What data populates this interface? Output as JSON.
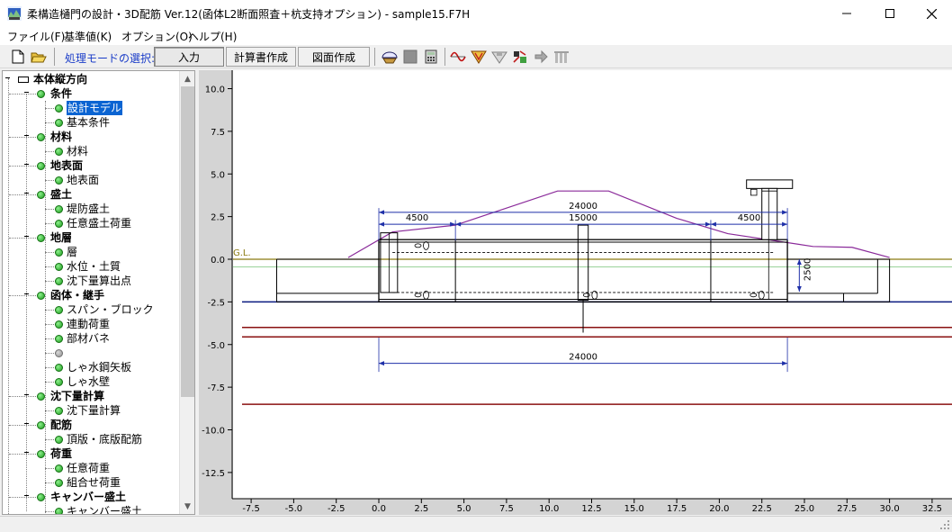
{
  "window": {
    "title": "柔構造樋門の設計・3D配筋 Ver.12(函体L2断面照査＋杭支持オプション) - sample15.F7H",
    "app_icon": "app-icon",
    "controls": [
      "minimize-icon",
      "maximize-icon",
      "close-icon"
    ]
  },
  "menu": {
    "items": [
      "ファイル(F)",
      "基準値(K)",
      "オプション(O)",
      "ヘルプ(H)"
    ]
  },
  "toolbar": {
    "mode_label": "処理モードの選択:",
    "input_label": "入力",
    "calc_label": "計算書作成",
    "drawing_label": "図面作成",
    "left_icons": [
      "new-file-icon",
      "open-folder-icon"
    ],
    "right_icons": [
      "ground-shape-icon",
      "gray-square-icon",
      "calculator-icon",
      "wave-load-icon",
      "earth-pressure-icon",
      "settlement-icon",
      "rebar-3d-icon",
      "pile-icon",
      "column-icon"
    ]
  },
  "tree": {
    "items": [
      {
        "label": "本体縦方向",
        "level": 0,
        "bold": true
      },
      {
        "label": "条件",
        "level": 1,
        "bold": true
      },
      {
        "label": "設計モデル",
        "level": 2,
        "selected": true
      },
      {
        "label": "基本条件",
        "level": 2
      },
      {
        "label": "材料",
        "level": 1,
        "bold": true
      },
      {
        "label": "材料",
        "level": 2
      },
      {
        "label": "地表面",
        "level": 1,
        "bold": true
      },
      {
        "label": "地表面",
        "level": 2
      },
      {
        "label": "盛土",
        "level": 1,
        "bold": true
      },
      {
        "label": "堤防盛土",
        "level": 2
      },
      {
        "label": "任意盛土荷重",
        "level": 2
      },
      {
        "label": "地層",
        "level": 1,
        "bold": true
      },
      {
        "label": "層",
        "level": 2
      },
      {
        "label": "水位・土質",
        "level": 2
      },
      {
        "label": "沈下量算出点",
        "level": 2
      },
      {
        "label": "函体・継手",
        "level": 1,
        "bold": true
      },
      {
        "label": "スパン・ブロック",
        "level": 2
      },
      {
        "label": "連動荷重",
        "level": 2
      },
      {
        "label": "部材バネ",
        "level": 2
      },
      {
        "label": "",
        "level": 2,
        "gray": true
      },
      {
        "label": "しゃ水鋼矢板",
        "level": 2
      },
      {
        "label": "しゃ水壁",
        "level": 2
      },
      {
        "label": "沈下量計算",
        "level": 1,
        "bold": true
      },
      {
        "label": "沈下量計算",
        "level": 2
      },
      {
        "label": "配筋",
        "level": 1,
        "bold": true
      },
      {
        "label": "頂版・底版配筋",
        "level": 2
      },
      {
        "label": "荷重",
        "level": 1,
        "bold": true
      },
      {
        "label": "任意荷重",
        "level": 2
      },
      {
        "label": "組合せ荷重",
        "level": 2
      },
      {
        "label": "キャンバー盛土",
        "level": 1,
        "bold": true
      },
      {
        "label": "キャンバー盛土",
        "level": 2
      }
    ]
  },
  "drawing": {
    "gl_label": "G.L.",
    "x_ticks": [
      "-7.5",
      "-5.0",
      "-2.5",
      "0.0",
      "2.5",
      "5.0",
      "7.5",
      "10.0",
      "12.5",
      "15.0",
      "17.5",
      "20.0",
      "22.5",
      "25.0",
      "27.5",
      "30.0",
      "32.5"
    ],
    "y_ticks": [
      "10.0",
      "7.5",
      "5.0",
      "2.5",
      "0.0",
      "-2.5",
      "-5.0",
      "-7.5",
      "-10.0",
      "-12.5"
    ],
    "dim_total_top": "24000",
    "dim_left": "4500",
    "dim_mid": "15000",
    "dim_right": "4500",
    "dim_height": "2500",
    "dim_total_bottom": "24000",
    "colors": {
      "dim_blue": "#1e2fa8",
      "embankment_purple": "#8a2a9a",
      "gl_olive": "#8a7a10",
      "stratum_red": "#8a1010",
      "water_navy": "#0a1a80",
      "light_green": "#9ad29a"
    }
  }
}
